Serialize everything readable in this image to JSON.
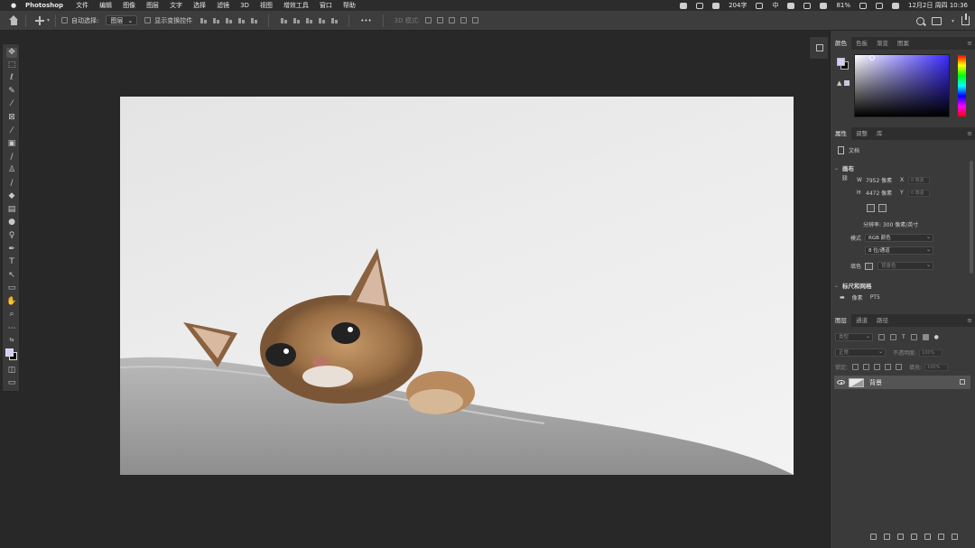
{
  "menubar": {
    "app_name": "Photoshop",
    "items": [
      "文件",
      "编辑",
      "图像",
      "图层",
      "文字",
      "选择",
      "滤镜",
      "3D",
      "视图",
      "增效工具",
      "窗口",
      "帮助"
    ],
    "word_count": "204字",
    "input_method": "中",
    "battery": "81%",
    "datetime": "12月2日 周四  10:36"
  },
  "options_bar": {
    "auto_select_label": "自动选择:",
    "auto_select_value": "图层",
    "show_transform_label": "显示变换控件",
    "mode_3d_label": "3D 模式:"
  },
  "panels": {
    "color_tabs": [
      "颜色",
      "色板",
      "渐变",
      "图案"
    ],
    "properties_tabs": [
      "属性",
      "调整",
      "库"
    ],
    "layers_tabs": [
      "图层",
      "通道",
      "路径"
    ]
  },
  "properties": {
    "doc_label": "文档",
    "canvas_section": "画布",
    "w_label": "W",
    "w_value": "7952 像素",
    "h_label": "H",
    "h_value": "4472 像素",
    "x_label": "X",
    "x_placeholder": "0 像素",
    "y_label": "Y",
    "y_placeholder": "0 像素",
    "resolution": "分辨率: 300 像素/英寸",
    "mode_label": "模式",
    "mode_value": "RGB 颜色",
    "depth_value": "8 位/通道",
    "fill_label": "填色",
    "fill_value": "背景色",
    "rulers_section": "标尺和网格",
    "rulers_unit": "像素",
    "rulers_value": "PT5"
  },
  "layers": {
    "filter_placeholder": "类型",
    "blend_mode": "正常",
    "opacity_label": "不透明度:",
    "opacity_value": "100%",
    "lock_label": "锁定:",
    "fill_label": "填充:",
    "fill_value": "100%",
    "layer_name": "背景"
  },
  "colors": {
    "foreground": "#d2cffa",
    "background": "#000000",
    "panel_bg": "#3a3a3a",
    "workspace_bg": "#282828"
  }
}
